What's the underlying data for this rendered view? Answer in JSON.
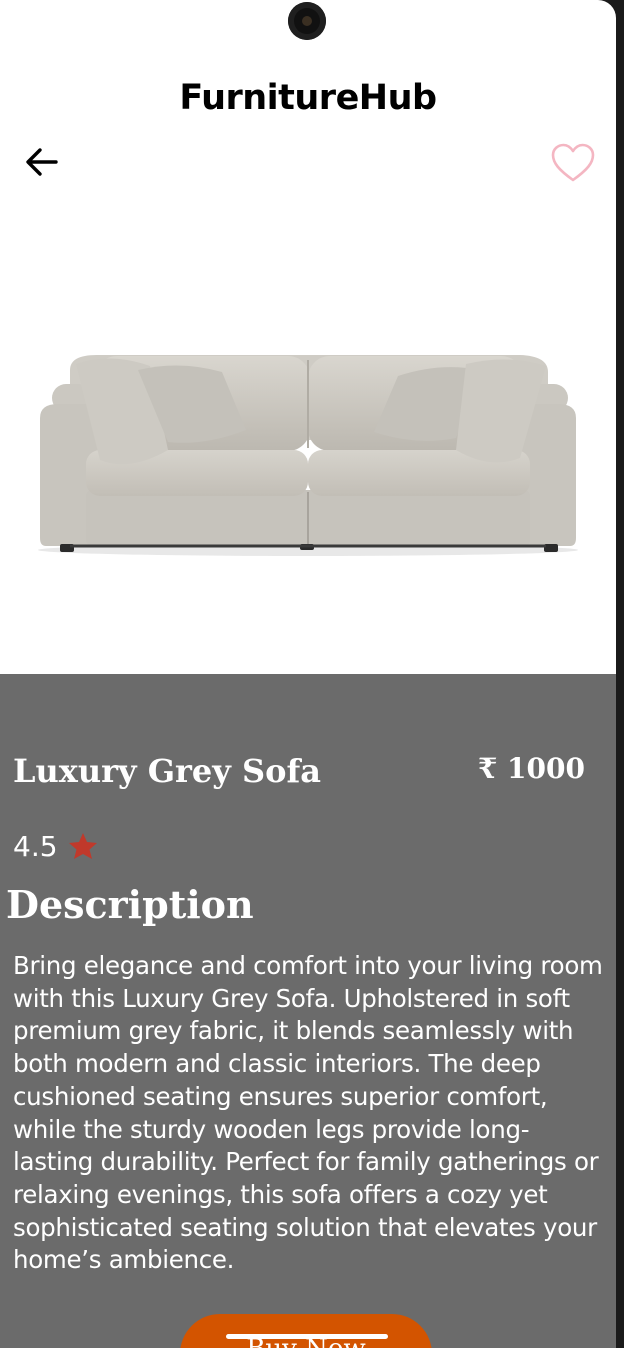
{
  "app": {
    "title": "FurnitureHub"
  },
  "icons": {
    "back": "arrow-left-icon",
    "favorite": "heart-outline-icon",
    "rating": "star-icon"
  },
  "product": {
    "image": "grey-sofa-image",
    "name": "Luxury Grey Sofa",
    "price": "₹ 1000",
    "rating": "4.5",
    "description_heading": "Description",
    "description": "Bring elegance and comfort into your living room with this Luxury Grey Sofa. Upholstered in soft premium grey fabric, it blends seamlessly with both modern and classic interiors. The deep cushioned seating ensures superior comfort, while the sturdy wooden legs provide long-lasting durability. Perfect for family gatherings or relaxing evenings, this sofa offers a cozy yet sophisticated seating solution that elevates your home’s ambience."
  },
  "actions": {
    "buy_label": "Buy Now"
  },
  "colors": {
    "details_bg": "#6b6b6b",
    "accent": "#d35400",
    "star": "#c0392b",
    "heart": "#f4b6c2"
  }
}
